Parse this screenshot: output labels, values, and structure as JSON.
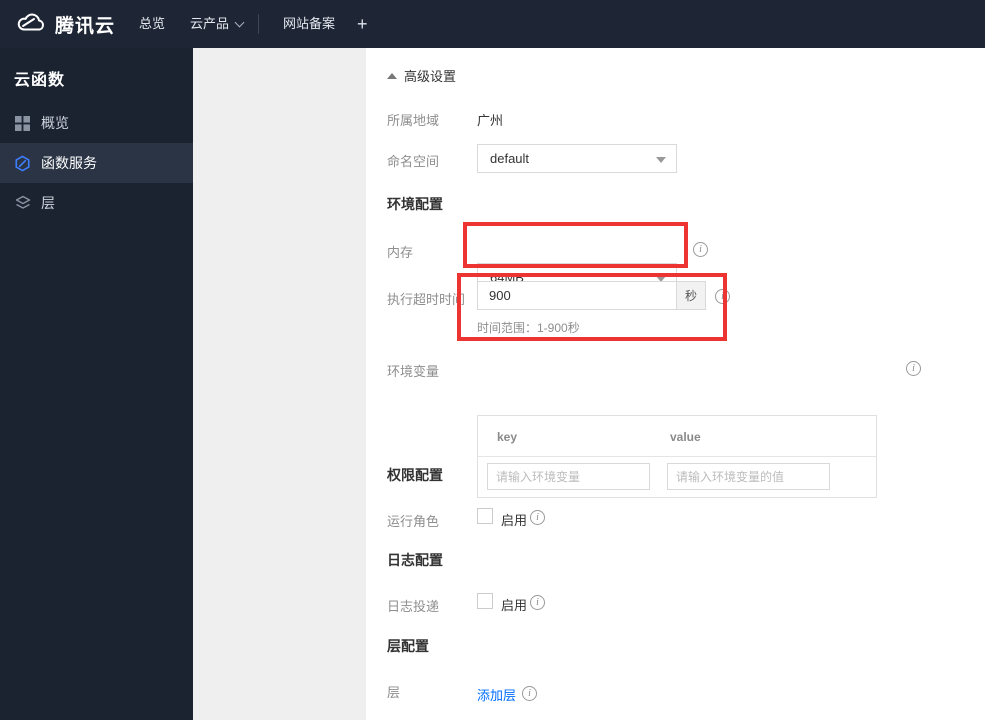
{
  "topbar": {
    "brand": "腾讯云",
    "nav_overview": "总览",
    "nav_products": "云产品",
    "nav_icp": "网站备案",
    "nav_add": "+"
  },
  "sidebar": {
    "title": "云函数",
    "items": [
      {
        "label": "概览",
        "icon": "grid-icon",
        "active": false
      },
      {
        "label": "函数服务",
        "icon": "function-hexagon-icon",
        "active": true
      },
      {
        "label": "层",
        "icon": "layers-icon",
        "active": false
      }
    ]
  },
  "main": {
    "advanced_settings": "高级设置",
    "region": {
      "label": "所属地域",
      "value": "广州"
    },
    "namespace": {
      "label": "命名空间",
      "value": "default"
    },
    "env_section_title": "环境配置",
    "memory": {
      "label": "内存",
      "value": "64MB"
    },
    "timeout": {
      "label": "执行超时时间",
      "value": "900",
      "unit": "秒",
      "hint": "时间范围：1-900秒"
    },
    "env_vars": {
      "label": "环境变量",
      "key_header": "key",
      "value_header": "value",
      "key_placeholder": "请输入环境变量",
      "value_placeholder": "请输入环境变量的值"
    },
    "perm_section_title": "权限配置",
    "run_role": {
      "label": "运行角色",
      "enable": "启用"
    },
    "log_section_title": "日志配置",
    "log_delivery": {
      "label": "日志投递",
      "enable": "启用"
    },
    "layer_section_title": "层配置",
    "layer": {
      "label": "层",
      "add_link": "添加层"
    }
  },
  "colors": {
    "annotation_red": "#ee3333",
    "link_blue": "#006eff",
    "function_icon_blue": "#3d7eff",
    "topbar_bg": "#1e2636",
    "sidebar_bg": "#1b2230"
  }
}
